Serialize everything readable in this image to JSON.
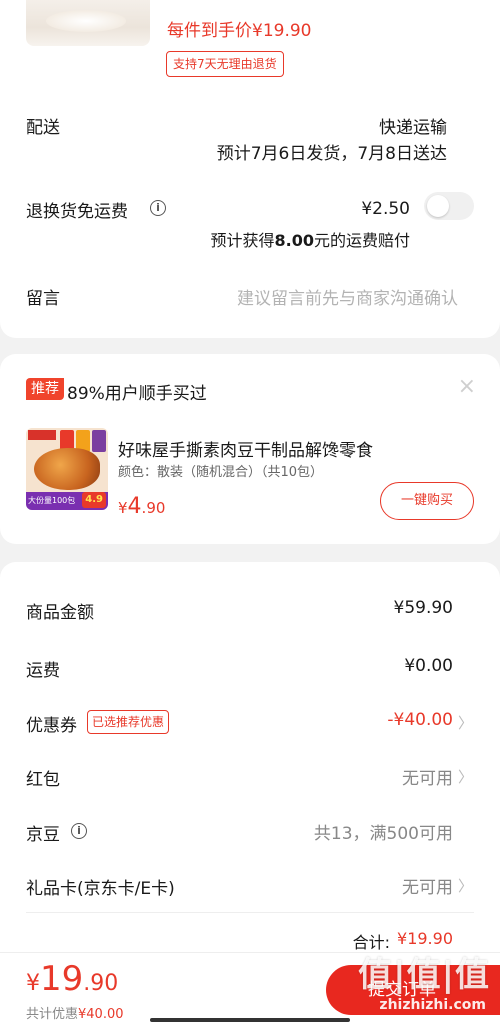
{
  "item": {
    "unit_price": "每件到手价¥19.90",
    "return_badge": "支持7天无理由退货"
  },
  "delivery": {
    "label": "配送",
    "method": "快递运输",
    "eta": "预计7月6日发货，7月8日送达"
  },
  "return_shipping": {
    "label": "退换货免运费",
    "price": "¥2.50",
    "compensation_prefix": "预计获得",
    "compensation_amount": "8.00",
    "compensation_suffix": "元的运费赔付",
    "toggle_on": false
  },
  "note": {
    "label": "留言",
    "placeholder": "建议留言前先与商家沟通确认"
  },
  "recommend": {
    "tag": "推荐",
    "title": "89%用户顺手买过",
    "close": "×",
    "product_name": "好味屋手撕素肉豆干制品解馋零食",
    "variant": "颜色：散装（随机混合）（共10包）",
    "price_currency": "¥",
    "price_int": "4",
    "price_dec": ".90",
    "image_promo": "大份量100包",
    "image_price": "4.9",
    "buy_button": "一键购买"
  },
  "summary": {
    "goods_label": "商品金额",
    "goods_value": "¥59.90",
    "shipping_label": "运费",
    "shipping_value": "¥0.00",
    "coupon_label": "优惠券",
    "coupon_tag": "已选推荐优惠",
    "coupon_value": "-¥40.00",
    "redpacket_label": "红包",
    "redpacket_value": "无可用",
    "jingdou_label": "京豆",
    "jingdou_value": "共13，满500可用",
    "giftcard_label": "礼品卡(京东卡/E卡)",
    "giftcard_value": "无可用",
    "total_label": "合计:",
    "total_value": "¥19.90"
  },
  "bottom": {
    "pay_currency": "¥",
    "pay_int": "19",
    "pay_dec": ".90",
    "discount_label": "共计优惠",
    "discount_value": "¥40.00",
    "submit": "提交订单",
    "watermark": "值|值|值",
    "watermark_sub": "zhizhizhi.com"
  },
  "colors": {
    "accent": "#e8392a",
    "submit": "#e8281f"
  }
}
